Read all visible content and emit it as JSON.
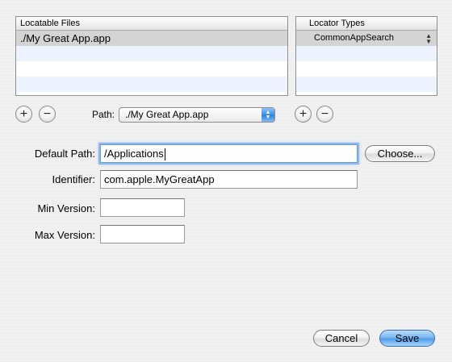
{
  "locatable_files": {
    "header": "Locatable Files",
    "rows": [
      "./My Great App.app",
      "",
      "",
      "",
      ""
    ]
  },
  "locator_types": {
    "header": "Locator Types",
    "rows": [
      "CommonAppSearch",
      "",
      "",
      "",
      ""
    ]
  },
  "file_controls": {
    "add": "+",
    "remove": "−"
  },
  "path_popup": {
    "label": "Path:",
    "value": "./My Great App.app"
  },
  "locator_controls": {
    "add": "+",
    "remove": "−"
  },
  "form": {
    "default_path": {
      "label": "Default Path:",
      "value": "/Applications"
    },
    "choose_button": "Choose...",
    "identifier": {
      "label": "Identifier:",
      "value": "com.apple.MyGreatApp"
    },
    "min_version": {
      "label": "Min Version:",
      "value": ""
    },
    "max_version": {
      "label": "Max Version:",
      "value": ""
    }
  },
  "buttons": {
    "cancel": "Cancel",
    "save": "Save"
  },
  "colors": {
    "selection_row": "#d4d4d4",
    "alt_row": "#edf3fe",
    "default_button": "#4f9ce8",
    "focus_ring": "#8bb8ef"
  }
}
